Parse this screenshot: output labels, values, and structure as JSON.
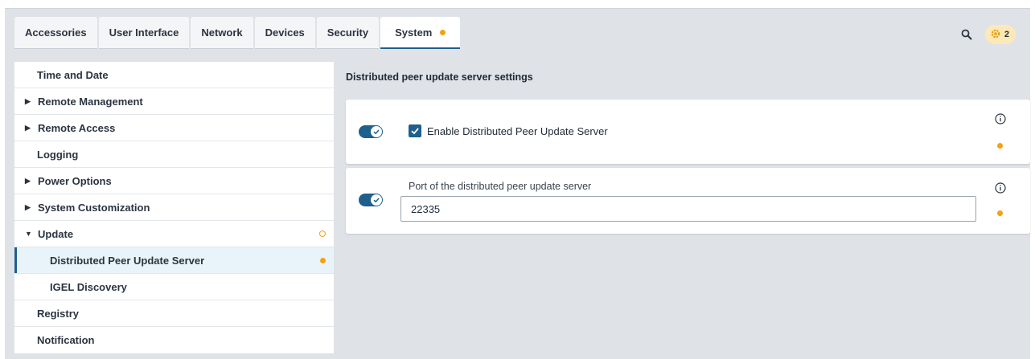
{
  "tabs": [
    {
      "label": "Accessories"
    },
    {
      "label": "User Interface"
    },
    {
      "label": "Network"
    },
    {
      "label": "Devices"
    },
    {
      "label": "Security"
    },
    {
      "label": "System",
      "active": true,
      "modified": true
    }
  ],
  "header": {
    "notifications_count": "2"
  },
  "sidebar": {
    "items": [
      {
        "label": "Time and Date"
      },
      {
        "label": "Remote Management"
      },
      {
        "label": "Remote Access"
      },
      {
        "label": "Logging"
      },
      {
        "label": "Power Options"
      },
      {
        "label": "System Customization"
      },
      {
        "label": "Update"
      },
      {
        "label": "Distributed Peer Update Server"
      },
      {
        "label": "IGEL Discovery"
      },
      {
        "label": "Registry"
      },
      {
        "label": "Notification"
      }
    ]
  },
  "main": {
    "section_title": "Distributed peer update server settings",
    "enable_setting": {
      "label": "Enable Distributed Peer Update Server",
      "checked": true
    },
    "port_setting": {
      "label": "Port of the distributed peer update server",
      "value": "22335"
    }
  },
  "colors": {
    "accent": "#1f5f8b",
    "modified_indicator": "#f2a20f",
    "background": "#dfe3e7"
  }
}
